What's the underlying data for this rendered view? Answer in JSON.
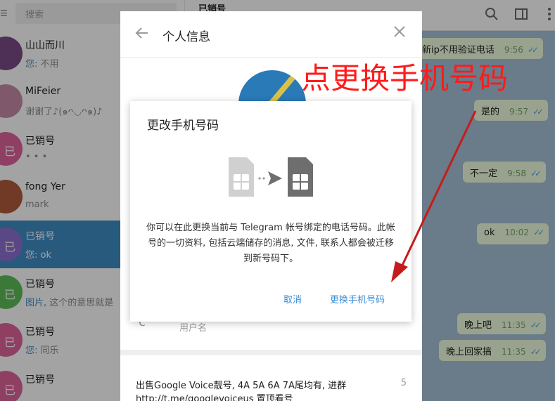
{
  "sidebar": {
    "search_placeholder": "搜索",
    "chats": [
      {
        "name": "山山而川",
        "preview_prefix": "您:",
        "preview": " 不用",
        "avatar_color": "#7a4a86",
        "avatar_letter": ""
      },
      {
        "name": "MiFeier",
        "preview_prefix": "",
        "preview": "谢谢了♪(๑ᴖ◡ᴖ๑)♪",
        "avatar_color": "#c98aa8",
        "avatar_letter": ""
      },
      {
        "name": "已销号",
        "preview_prefix": "",
        "preview": "• • •",
        "avatar_color": "#e0659a",
        "avatar_letter": "已"
      },
      {
        "name": "fong Yer",
        "preview_prefix": "",
        "preview": "mark",
        "avatar_color": "#b05c3c",
        "avatar_letter": ""
      },
      {
        "name": "已销号",
        "preview_prefix": "您:",
        "preview": " ok",
        "avatar_color": "#8e6fd0",
        "avatar_letter": "已",
        "active": true
      },
      {
        "name": "已销号",
        "preview_prefix": "图片,",
        "preview": " 这个的意思就是",
        "avatar_color": "#5fbe5a",
        "avatar_letter": "已"
      },
      {
        "name": "已销号",
        "preview_prefix": "您:",
        "preview": " 同乐",
        "avatar_color": "#e0659a",
        "avatar_letter": "已"
      },
      {
        "name": "已销号",
        "preview_prefix": "",
        "preview": "",
        "avatar_color": "#e0659a",
        "avatar_letter": "已"
      }
    ]
  },
  "chat": {
    "title": "已销号",
    "messages": [
      {
        "text": "新ip不用验证电话",
        "time": "9:56"
      },
      {
        "text": "是的",
        "time": "9:57"
      },
      {
        "text": "不一定",
        "time": "9:58"
      },
      {
        "text": "ok",
        "time": "10:02"
      },
      {
        "text": "晚上吧",
        "time": "11:35"
      },
      {
        "text": "晚上回家搞",
        "time": "11:35"
      }
    ]
  },
  "info_panel": {
    "title": "个人信息",
    "username_label": "用户名",
    "ad_line1": "出售Google Voice靓号, 4A 5A 6A 7A尾均有, 进群",
    "ad_line2": "http://t.me/googlevoiceus 置顶看号",
    "ad_count": "5"
  },
  "modal": {
    "title": "更改手机号码",
    "description": "你可以在此更换当前与 Telegram 帐号绑定的电话号码。此帐号的一切资料, 包括云端储存的消息, 文件, 联系人都会被迁移到新号码下。",
    "cancel_label": "取消",
    "change_label": "更换手机号码"
  },
  "annotation": {
    "text": "点更换手机号码",
    "color": "#ff1b1b"
  },
  "colors": {
    "accent": "#3f8ec5",
    "link": "#3c8fd6",
    "chat_bg": "#a7c1d6",
    "bubble": "#effdde"
  }
}
